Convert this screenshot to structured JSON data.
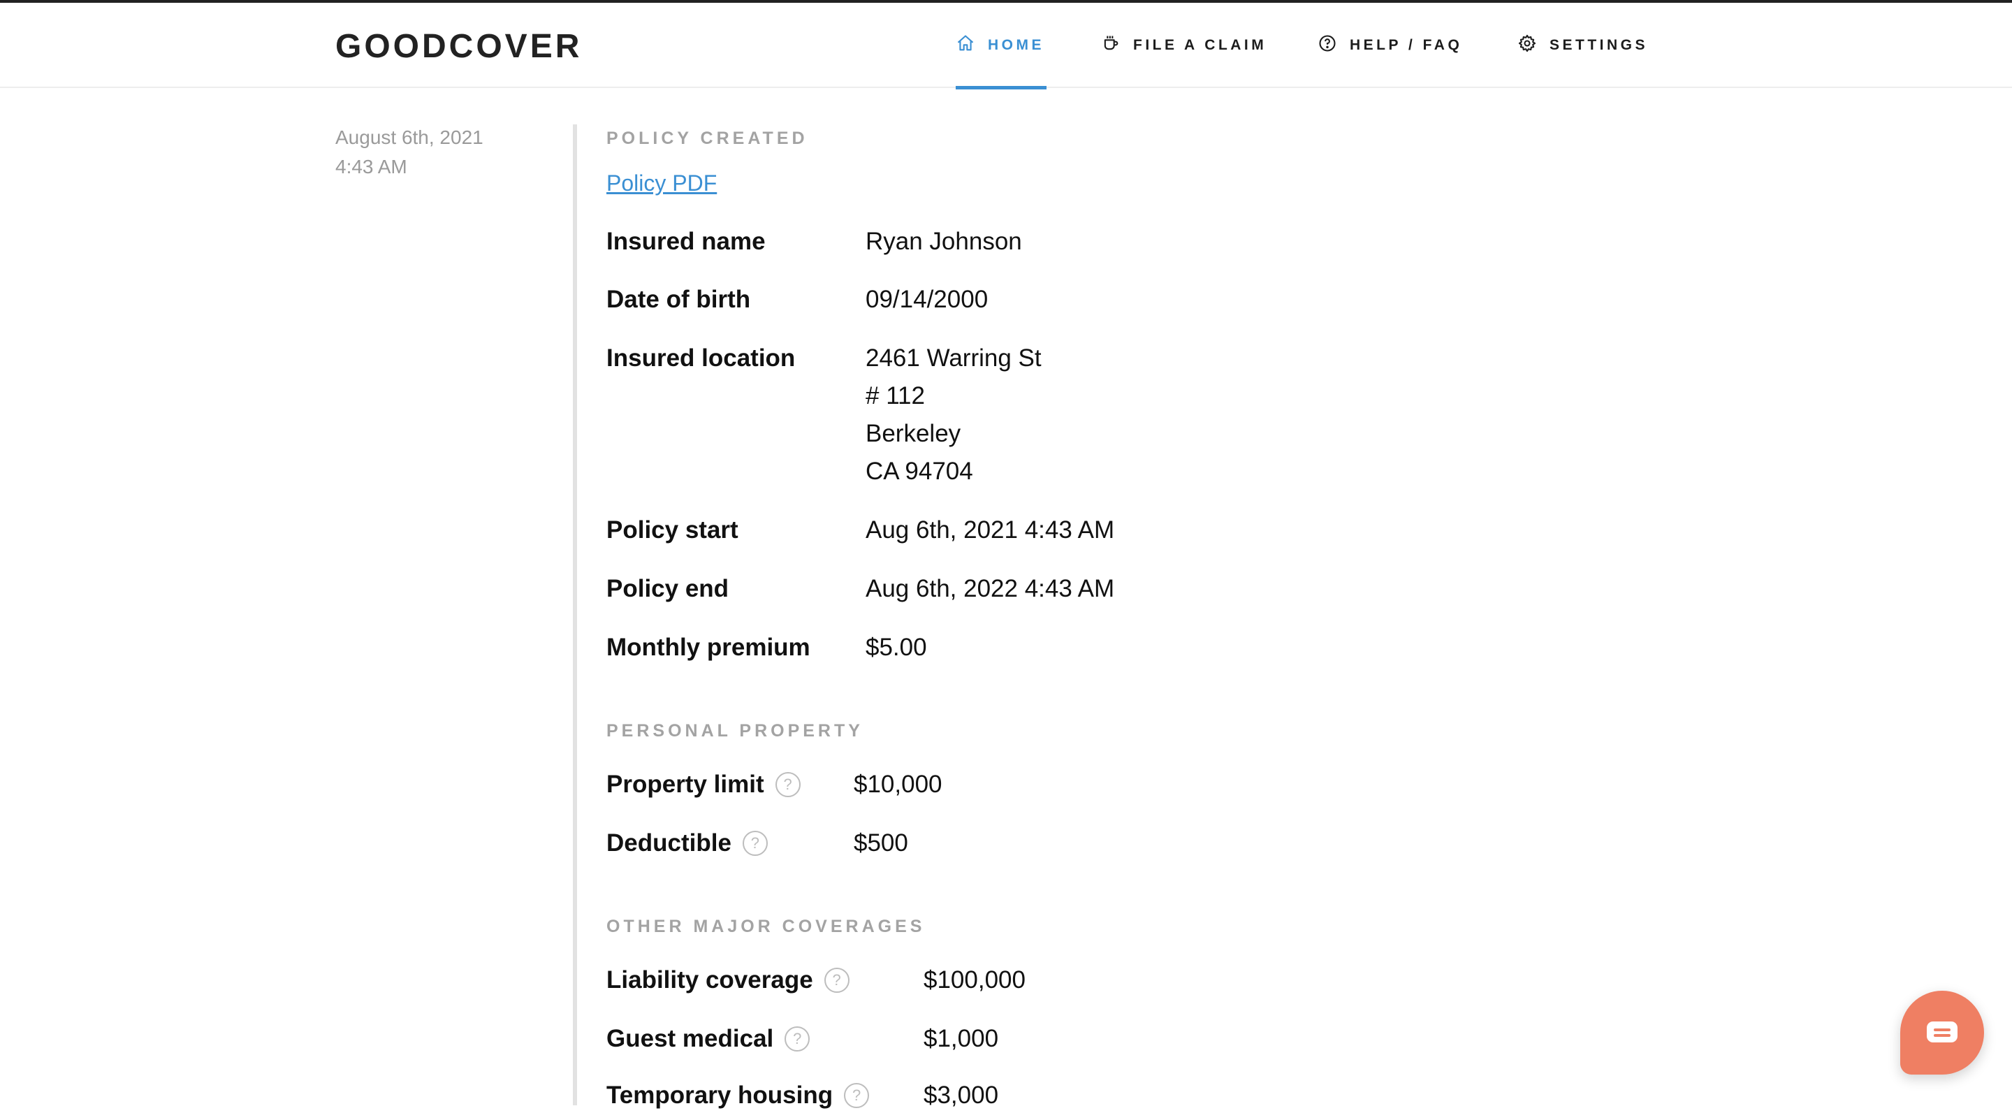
{
  "app": {
    "logo": "GOODCOVER"
  },
  "nav": {
    "items": [
      {
        "label": "HOME",
        "icon": "home-icon",
        "active": true
      },
      {
        "label": "FILE A CLAIM",
        "icon": "cup-icon",
        "active": false
      },
      {
        "label": "HELP / FAQ",
        "icon": "help-circle-icon",
        "active": false
      },
      {
        "label": "SETTINGS",
        "icon": "gear-icon",
        "active": false
      }
    ]
  },
  "timeline": {
    "date": "August 6th, 2021",
    "time": "4:43 AM"
  },
  "policy": {
    "section_title": "POLICY CREATED",
    "pdf_link": "Policy PDF",
    "fields": [
      {
        "label": "Insured name",
        "value": "Ryan Johnson"
      },
      {
        "label": "Date of birth",
        "value": "09/14/2000"
      },
      {
        "label": "Insured location",
        "value": [
          "2461 Warring St",
          "# 112",
          "Berkeley",
          "CA 94704"
        ]
      },
      {
        "label": "Policy start",
        "value": "Aug 6th, 2021 4:43 AM"
      },
      {
        "label": "Policy end",
        "value": "Aug 6th, 2022 4:43 AM"
      },
      {
        "label": "Monthly premium",
        "value": "$5.00"
      }
    ]
  },
  "personal_property": {
    "section_title": "PERSONAL PROPERTY",
    "fields": [
      {
        "label": "Property limit",
        "value": "$10,000",
        "help": true
      },
      {
        "label": "Deductible",
        "value": "$500",
        "help": true
      }
    ]
  },
  "other_coverages": {
    "section_title": "OTHER MAJOR COVERAGES",
    "fields": [
      {
        "label": "Liability coverage",
        "value": "$100,000",
        "help": true
      },
      {
        "label": "Guest medical",
        "value": "$1,000",
        "help": true
      },
      {
        "label": "Temporary housing",
        "value": "$3,000",
        "help": true
      }
    ]
  },
  "help_glyph": "?",
  "colors": {
    "accent": "#3a8fd3",
    "chat_button": "#ef7f63",
    "muted": "#a3a3a3"
  }
}
